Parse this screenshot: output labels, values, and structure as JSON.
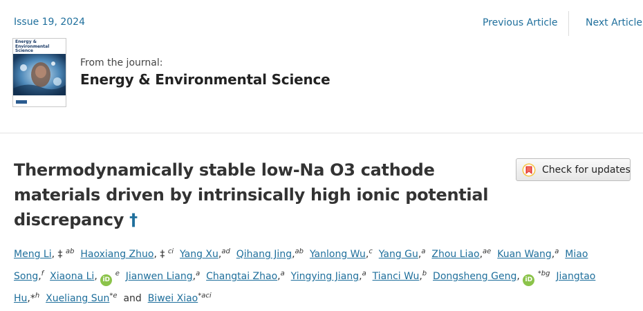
{
  "header": {
    "issue": "Issue 19, 2024",
    "previous_label": "Previous Article",
    "next_label": "Next Article"
  },
  "journal": {
    "cover_title": "Energy & Environmental Science",
    "from_label": "From the journal:",
    "name": "Energy & Environmental Science"
  },
  "article": {
    "title_l1": "Thermodynamically stable low-Na O3 cathode",
    "title_l2": "materials driven by intrinsically high ionic potential",
    "title_l3": "discrepancy",
    "dagger": "†",
    "check_updates_label": "Check for updates",
    "authors": {
      "a1": "Meng Li",
      "s1": ", ‡",
      "f1": "ab",
      "a2": "Haoxiang Zhuo",
      "s2": ", ‡",
      "f2": "ci",
      "a3": "Yang Xu",
      "s3": ",",
      "f3": "ad",
      "a4": "Qihang Jing",
      "s4": ",",
      "f4": "ab",
      "a5": "Yanlong Wu",
      "s5": ",",
      "f5": "c",
      "a6": "Yang Gu",
      "s6": ",",
      "f6": "a",
      "a7": "Zhou Liao",
      "s7": ",",
      "f7": "ae",
      "a8": "Kuan Wang",
      "s8": ",",
      "f8": "a",
      "a9_l1": "Miao",
      "a9_l2": "Song",
      "s9": ",",
      "f9": "f",
      "a10": "Xiaona Li",
      "s10": ",",
      "f10": "e",
      "a11": "Jianwen Liang",
      "s11": ",",
      "f11": "a",
      "a12": "Changtai Zhao",
      "s12": ",",
      "f12": "a",
      "a13": "Yingying Jiang",
      "s13": ",",
      "f13": "a",
      "a14": "Tianci Wu",
      "s14": ",",
      "f14": "b",
      "a15": "Dongsheng Geng",
      "s15": ",",
      "f15": "*bg",
      "a16_l1": "Jiangtao",
      "a16_l2": "Hu",
      "s16": ",*",
      "f16": "h",
      "a17": "Xueliang Sun",
      "f17": "*e",
      "and": "and",
      "a18": "Biwei Xiao",
      "f18": "*aci",
      "orcid": "iD"
    }
  },
  "colors": {
    "link": "#1f6f9c",
    "text": "#333333",
    "orcid": "#8bc34a",
    "crossmark_red": "#e0342f",
    "crossmark_yellow": "#f6c443"
  },
  "icons": [
    "orcid-icon",
    "crossmark-icon"
  ]
}
